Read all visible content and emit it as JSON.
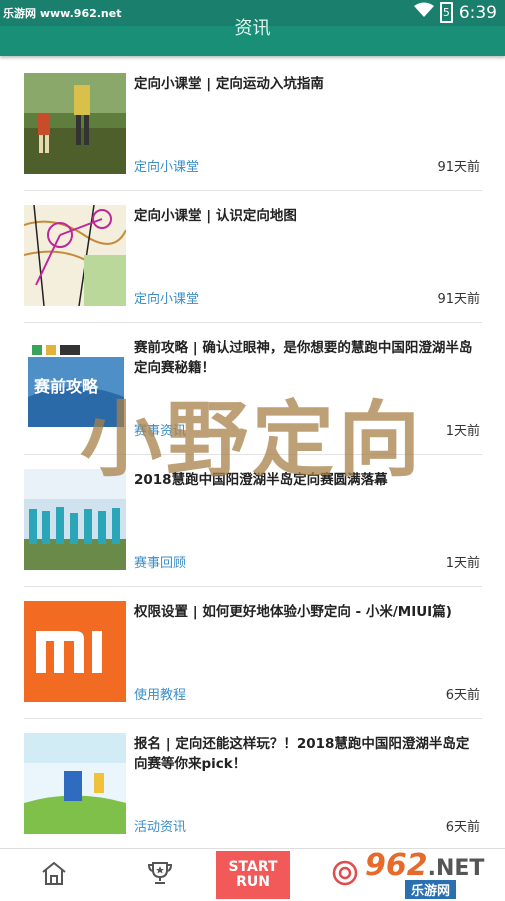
{
  "status": {
    "watermark": "乐游网 www.962.net",
    "time": "6:39",
    "battery_level": "5"
  },
  "header": {
    "title": "资讯"
  },
  "items": [
    {
      "title": "定向小课堂 | 定向运动入坑指南",
      "category": "定向小课堂",
      "time": "91天前"
    },
    {
      "title": "定向小课堂 | 认识定向地图",
      "category": "定向小课堂",
      "time": "91天前"
    },
    {
      "title": "赛前攻略 | 确认过眼神，是你想要的慧跑中国阳澄湖半岛定向赛秘籍！",
      "category": "赛事资讯",
      "time": "1天前"
    },
    {
      "title": "2018慧跑中国阳澄湖半岛定向赛圆满落幕",
      "category": "赛事回顾",
      "time": "1天前"
    },
    {
      "title": "权限设置 | 如何更好地体验小野定向 - 小米/MIUI篇)",
      "category": "使用教程",
      "time": "6天前"
    },
    {
      "title": "报名 | 定向还能这样玩？！2018慧跑中国阳澄湖半岛定向赛等你来pick！",
      "category": "活动资讯",
      "time": "6天前"
    }
  ],
  "thumb_text": {
    "banner": "赛前攻略"
  },
  "overlay_watermark": "小野定向",
  "bottom_nav": {
    "start_line1": "START",
    "start_line2": "RUN"
  },
  "corner_watermark": {
    "big": "962",
    "suffix": ".NET",
    "small": "乐游网"
  }
}
